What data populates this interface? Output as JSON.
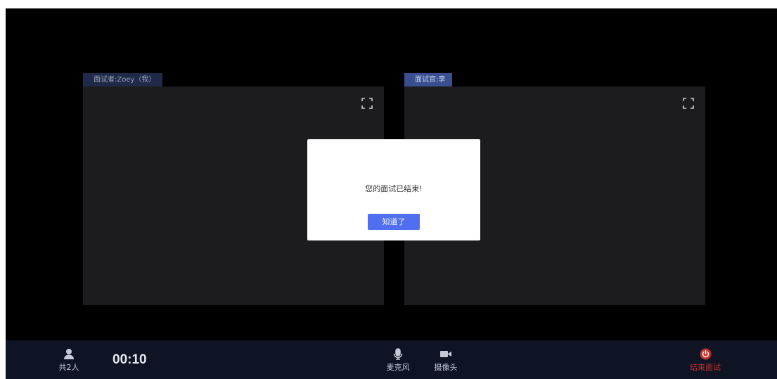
{
  "panels": {
    "left_label": "面试者:Zoey（我）",
    "right_label": "面试官:李"
  },
  "toolbar": {
    "participants_label": "共2人",
    "timer": "00:10",
    "mic_label": "麦克风",
    "camera_label": "摄像头",
    "end_label": "结束面试"
  },
  "modal": {
    "message": "您的面试已结束!",
    "button_label": "知道了"
  },
  "icons": {
    "fullscreen": "fullscreen-icon",
    "user": "user-icon",
    "microphone": "microphone-icon",
    "camera": "camera-icon",
    "power": "power-icon"
  },
  "colors": {
    "accent": "#4f6ef0",
    "danger": "#c0322b",
    "toolbar_bg": "#0e1424"
  }
}
